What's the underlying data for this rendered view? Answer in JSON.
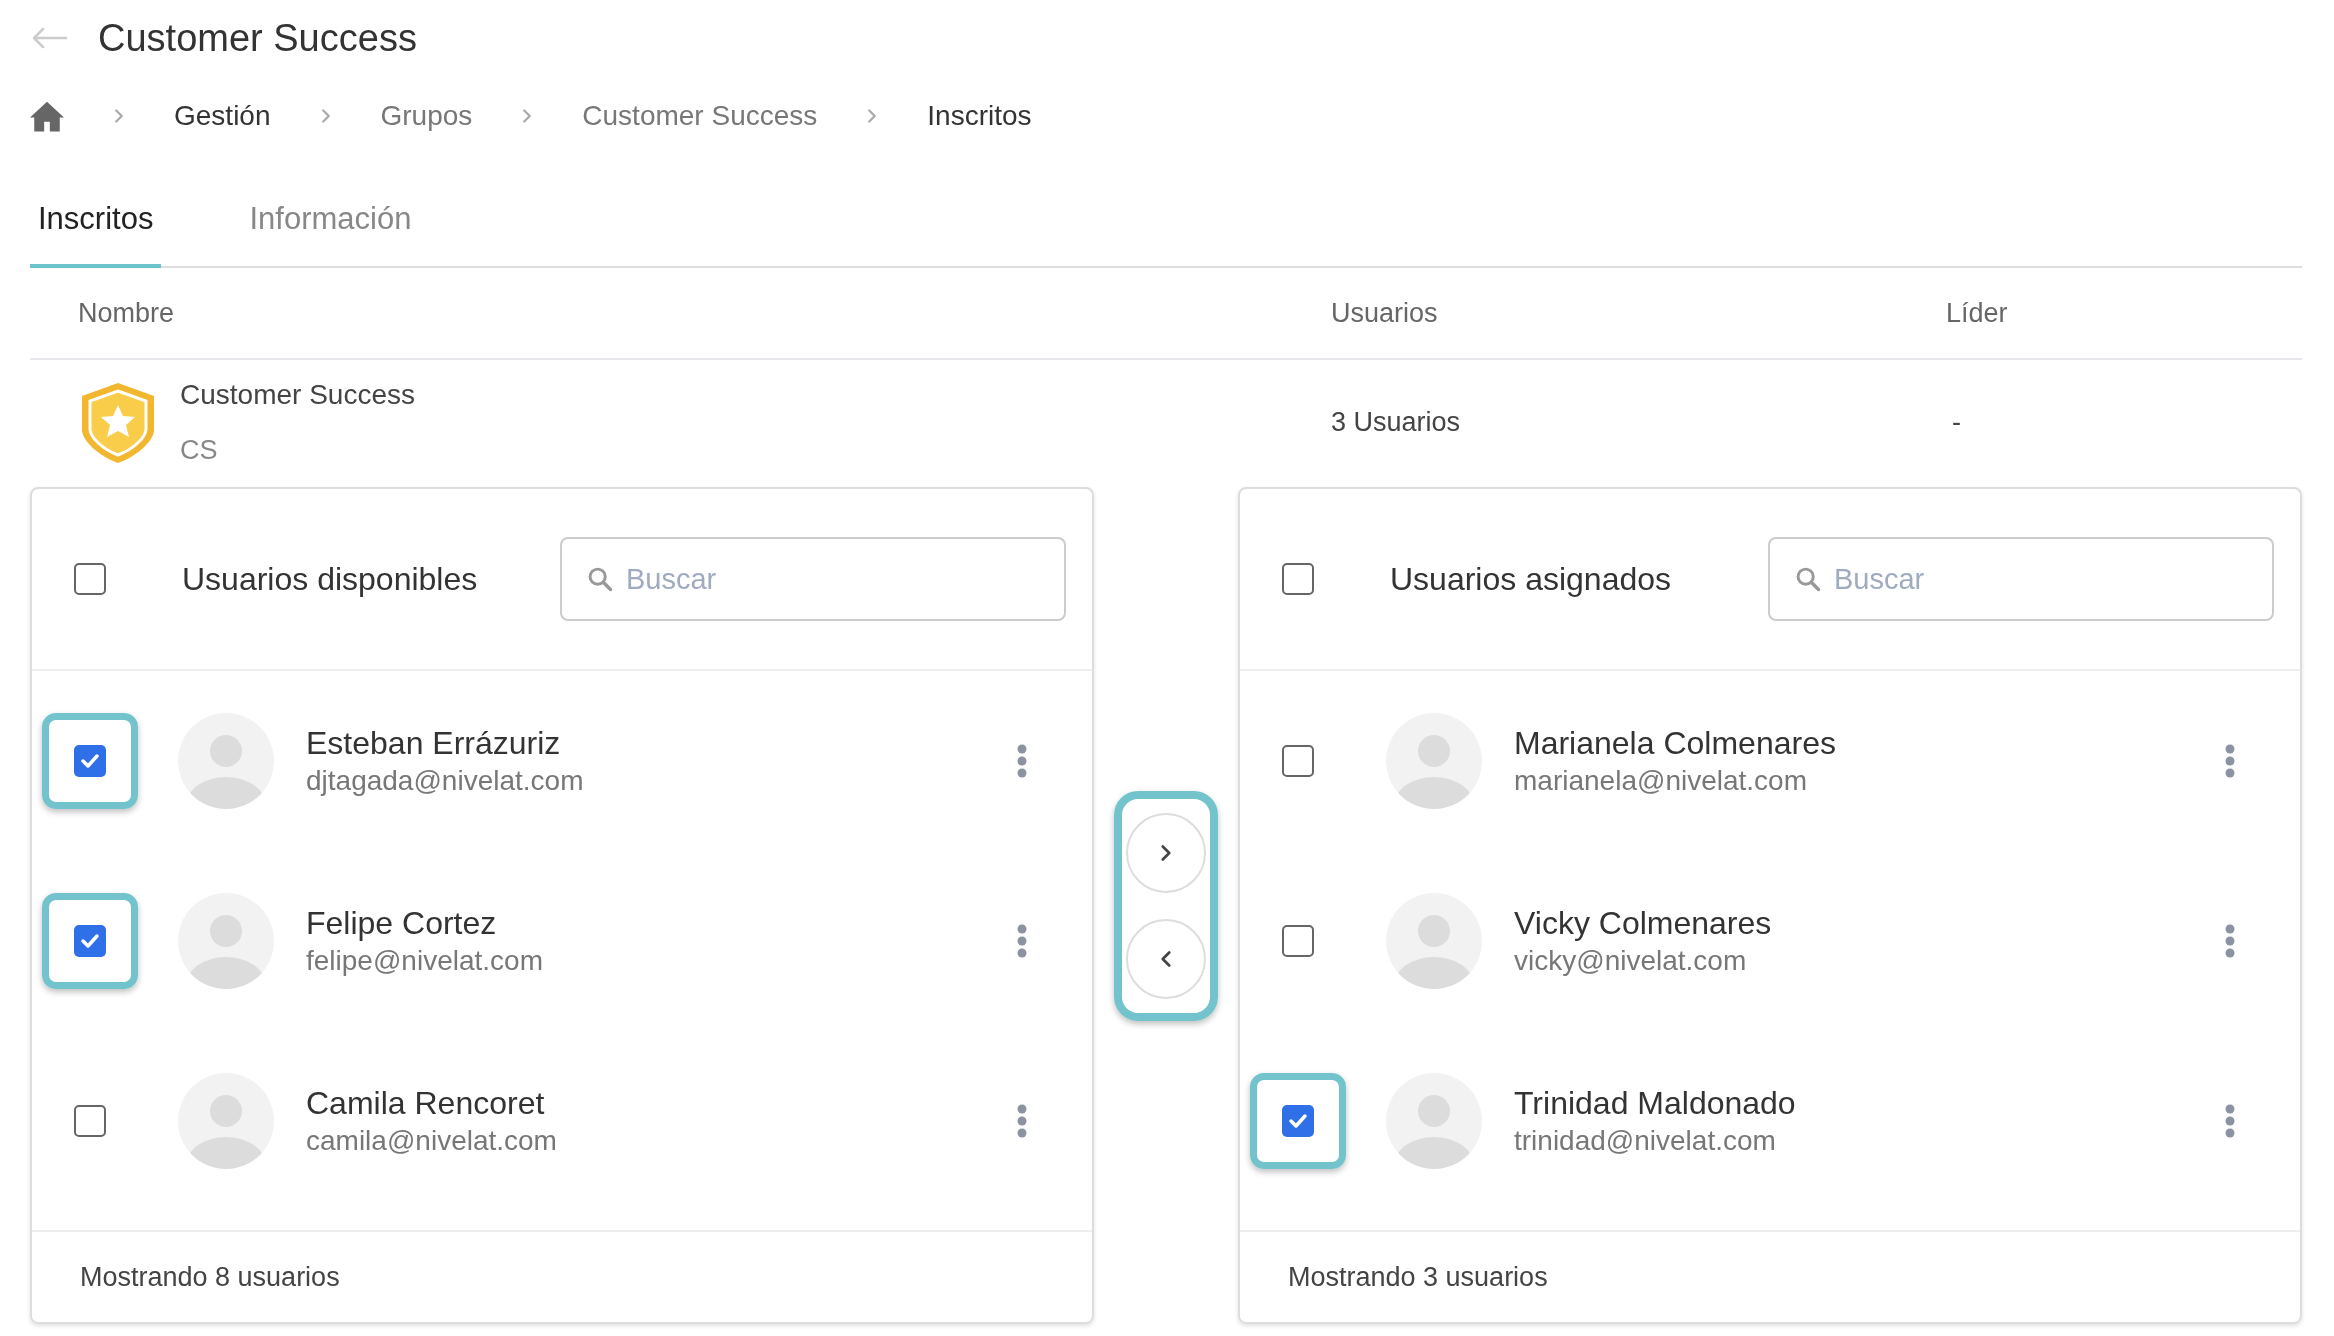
{
  "header": {
    "title": "Customer Success"
  },
  "breadcrumb": [
    {
      "label": "Gestión",
      "dark": true
    },
    {
      "label": "Grupos",
      "dark": false
    },
    {
      "label": "Customer Success",
      "dark": false
    },
    {
      "label": "Inscritos",
      "dark": true
    }
  ],
  "tabs": [
    {
      "label": "Inscritos",
      "selected": true
    },
    {
      "label": "Información",
      "selected": false
    }
  ],
  "table": {
    "columns": [
      "Nombre",
      "Usuarios",
      "Líder"
    ],
    "rows": [
      {
        "name": "Customer Success",
        "code": "CS",
        "users": "3 Usuarios",
        "leader": "-"
      }
    ]
  },
  "panels": [
    {
      "title": "Usuarios disponibles",
      "select_all": false,
      "search": {
        "placeholder": "Buscar"
      },
      "footer": "Mostrando 8 usuarios",
      "users": [
        {
          "name": "Esteban Errázuriz",
          "email": "djtagada@nivelat.com",
          "checked": true
        },
        {
          "name": "Felipe Cortez",
          "email": "felipe@nivelat.com",
          "checked": true
        },
        {
          "name": "Camila Rencoret",
          "email": "camila@nivelat.com",
          "checked": false
        }
      ]
    },
    {
      "title": "Usuarios asignados",
      "select_all": false,
      "search": {
        "placeholder": "Buscar"
      },
      "footer": "Mostrando 3 usuarios",
      "users": [
        {
          "name": "Marianela Colmenares",
          "email": "marianela@nivelat.com",
          "checked": false
        },
        {
          "name": "Vicky Colmenares",
          "email": "vicky@nivelat.com",
          "checked": false
        },
        {
          "name": "Trinidad Maldonado",
          "email": "trinidad@nivelat.com",
          "checked": true
        }
      ]
    }
  ],
  "transfer": {
    "highlighted": true
  }
}
